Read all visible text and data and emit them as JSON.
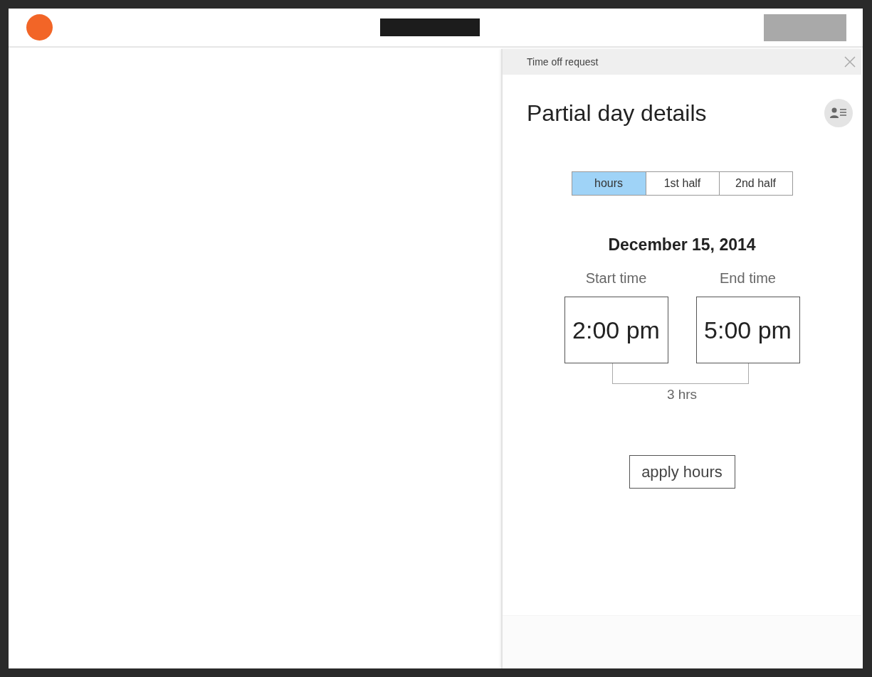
{
  "panel": {
    "title": "Time off request",
    "heading": "Partial day details",
    "segments": [
      {
        "label": "hours",
        "selected": true
      },
      {
        "label": "1st half",
        "selected": false
      },
      {
        "label": "2nd half",
        "selected": false
      }
    ],
    "date": "December 15, 2014",
    "times": [
      {
        "label": "Start time",
        "value": "2:00 pm"
      },
      {
        "label": "End time",
        "value": "5:00 pm"
      }
    ],
    "duration": "3 hrs",
    "action": "apply hours"
  }
}
